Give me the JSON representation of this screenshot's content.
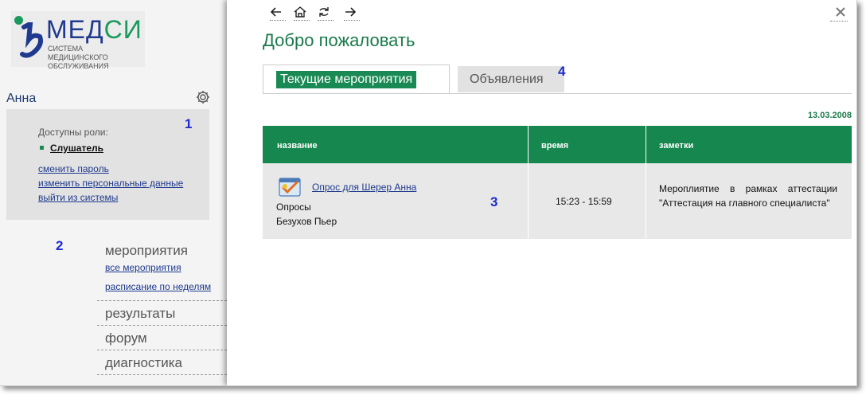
{
  "logo": {
    "wordmark_a": "МЕД",
    "wordmark_b": "СИ",
    "subtitle": "Система медицинского\nобслуживания",
    "colors": {
      "primary": "#1f3a8e",
      "secondary": "#1a9a5a"
    }
  },
  "sidebar": {
    "user_name": "Анна",
    "settings_icon": "gear-icon",
    "roles_title": "Доступны роли:",
    "role": "Слушатель",
    "links": {
      "change_password": "сменить пароль",
      "edit_profile": "изменить персональные данные",
      "logout": "выйти из системы"
    },
    "menu": {
      "events": {
        "title": "мероприятия",
        "all_events": "все мероприятия",
        "weekly_schedule": "расписание по неделям"
      },
      "results": "результаты",
      "forum": "форум",
      "diagnostics": "диагностика"
    }
  },
  "annotations": {
    "a1": "1",
    "a2": "2",
    "a3": "3",
    "a4": "4"
  },
  "toolbar": {
    "icons": [
      "arrow-left-icon",
      "home-icon",
      "refresh-icon",
      "arrow-right-icon",
      "close-icon"
    ]
  },
  "main": {
    "welcome": "Добро пожаловать",
    "tabs": {
      "current": "Текущие мероприятия",
      "announcements": "Объявления"
    },
    "date": "13.03.2008",
    "table": {
      "headers": {
        "name": "название",
        "time": "время",
        "notes": "заметки"
      },
      "rows": [
        {
          "link": "Опрос для Шерер Анна",
          "type": "Опросы",
          "person": "Безухов Пьер",
          "time": "15:23 - 15:59",
          "notes": "Мероплиятие в рамках аттестации \"Аттестация на главного специалиста\""
        }
      ]
    }
  },
  "colors": {
    "accent_green": "#15874f",
    "link_blue": "#1f3a8e",
    "annotation_blue": "#1a2bd0"
  }
}
